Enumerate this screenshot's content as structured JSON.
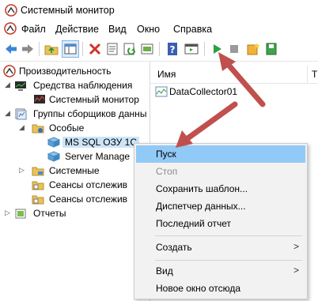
{
  "window": {
    "title": "Системный монитор"
  },
  "menubar": {
    "items": [
      "Файл",
      "Действие",
      "Вид",
      "Окно",
      "Справка"
    ]
  },
  "tree": {
    "items": [
      "Производительность",
      "Средства наблюдения",
      "Системный монитор",
      "Группы сборщиков данны",
      "Особые",
      "MS SQL ОЗУ 1С",
      "Server Manage",
      "Системные",
      "Сеансы отслежив",
      "Сеансы отслежив",
      "Отчеты"
    ]
  },
  "list": {
    "columns": [
      "Имя",
      "Т"
    ],
    "rows": [
      "DataCollector01"
    ]
  },
  "context_menu": {
    "items": [
      "Пуск",
      "Стоп",
      "Сохранить шаблон...",
      "Диспетчер данных...",
      "Последний отчет",
      "Создать",
      "Вид",
      "Новое окно отсюда"
    ],
    "submenu_arrow": ">"
  },
  "colors": {
    "accent_arrow": "#c0504d",
    "highlight": "#91c9f7",
    "selection": "#cce4f7"
  }
}
